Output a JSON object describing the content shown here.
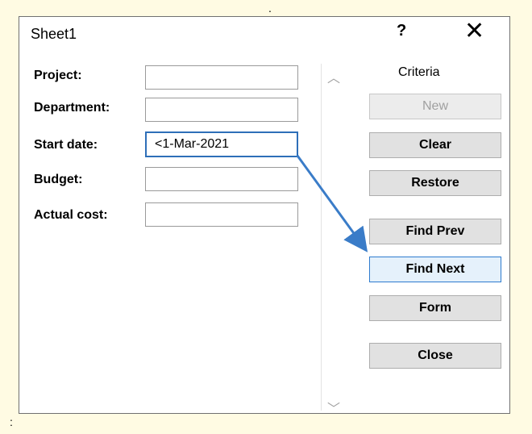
{
  "dialog": {
    "title": "Sheet1",
    "help_label": "?",
    "close_label": "✕"
  },
  "fields": [
    {
      "label": "Project:",
      "value": ""
    },
    {
      "label": "Department:",
      "value": ""
    },
    {
      "label": "Start date:",
      "value": "<1-Mar-2021"
    },
    {
      "label": "Budget:",
      "value": ""
    },
    {
      "label": "Actual cost:",
      "value": ""
    }
  ],
  "criteria_label": "Criteria",
  "buttons": {
    "new": "New",
    "clear": "Clear",
    "restore": "Restore",
    "find_prev": "Find Prev",
    "find_next": "Find Next",
    "form": "Form",
    "close": "Close"
  },
  "scroll": {
    "up_icon": "chevron-up-icon",
    "down_icon": "chevron-down-icon"
  },
  "colors": {
    "highlight_border": "#2e6fb8",
    "arrow": "#3a7cc8",
    "background": "#fffbe3"
  }
}
